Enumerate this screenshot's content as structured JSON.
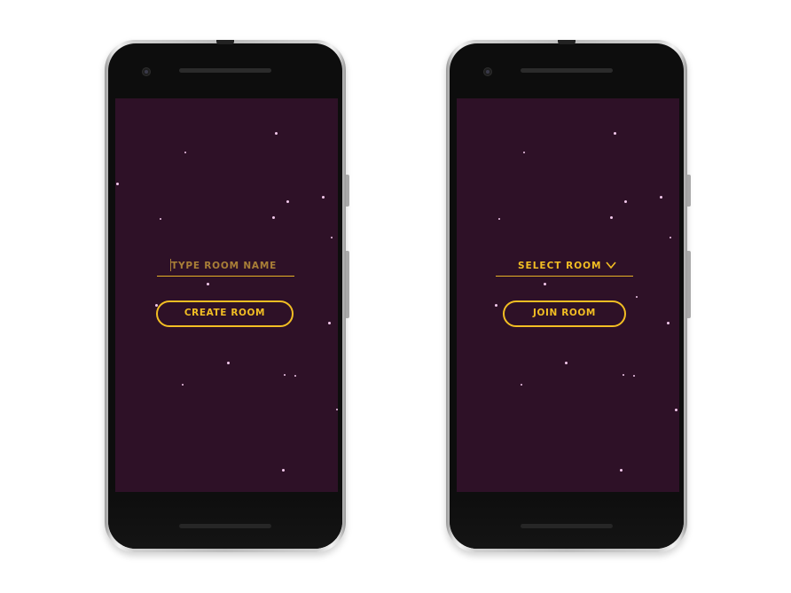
{
  "create_screen": {
    "input": {
      "placeholder": "TYPE ROOM NAME"
    },
    "button": {
      "label": "CREATE ROOM"
    }
  },
  "join_screen": {
    "select": {
      "label": "SELECT ROOM",
      "icon": "chevron-down-icon"
    },
    "button": {
      "label": "JOIN ROOM"
    }
  },
  "colors": {
    "screen_background": "#2e1127",
    "accent": "#f2be23",
    "placeholder_text": "#a97f37",
    "star": "#f3c9ec"
  }
}
